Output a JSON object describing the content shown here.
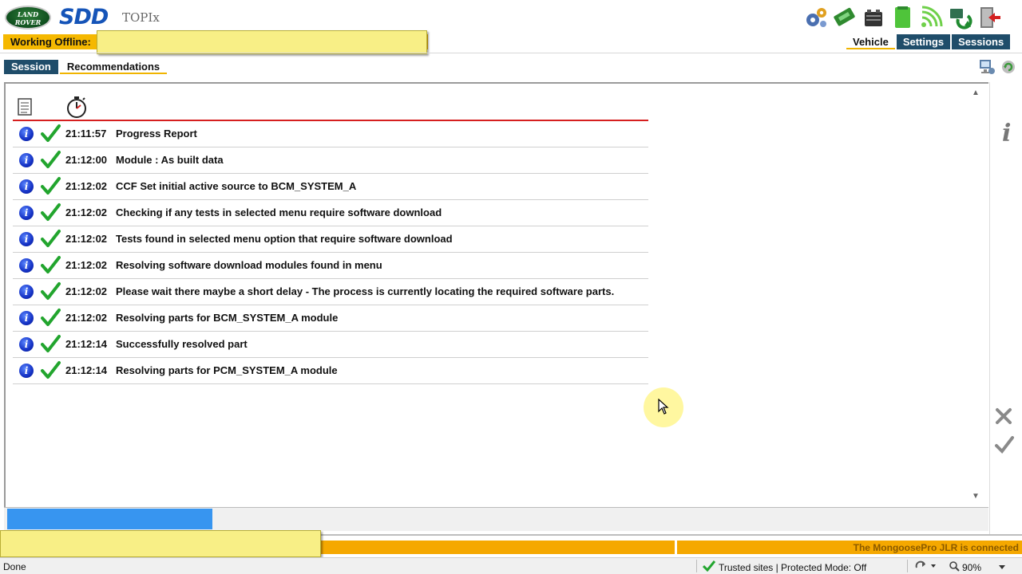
{
  "header": {
    "logo_text": "LAND ROVER",
    "app_name": "SDD",
    "subtitle": "TOPIx",
    "offline_label": "Working Offline:",
    "offline_value": ""
  },
  "toolbar": {
    "icons": [
      "settings-gears-icon",
      "vehicle-interface-icon",
      "battery-icon",
      "document-green-icon",
      "wireless-signal-icon",
      "network-refresh-icon",
      "exit-door-icon"
    ]
  },
  "main_tabs": {
    "vehicle": "Vehicle",
    "settings": "Settings",
    "sessions": "Sessions"
  },
  "sub_tabs": {
    "session": "Session",
    "recommendations": "Recommendations"
  },
  "log": {
    "columns": [
      "document-icon",
      "stopwatch-icon"
    ],
    "rows": [
      {
        "time": "21:11:57",
        "message": "Progress Report"
      },
      {
        "time": "21:12:00",
        "message": "Module : As built data"
      },
      {
        "time": "21:12:02",
        "message": "CCF Set initial active source to BCM_SYSTEM_A"
      },
      {
        "time": "21:12:02",
        "message": "Checking if any tests in selected menu require software download"
      },
      {
        "time": "21:12:02",
        "message": "Tests found in selected menu option that require software download"
      },
      {
        "time": "21:12:02",
        "message": "Resolving software download modules found in menu"
      },
      {
        "time": "21:12:02",
        "message": "Please wait there maybe a short delay - The process is currently locating the required software parts."
      },
      {
        "time": "21:12:02",
        "message": "Resolving parts for BCM_SYSTEM_A module"
      },
      {
        "time": "21:12:14",
        "message": "Successfully resolved part"
      },
      {
        "time": "21:12:14",
        "message": "Resolving parts for PCM_SYSTEM_A module"
      }
    ]
  },
  "progress": {
    "fraction": 0.21
  },
  "footer": {
    "connection_text": "The MongoosePro JLR is connected"
  },
  "statusbar": {
    "left": "Done",
    "security": "Trusted sites | Protected Mode: Off",
    "zoom": "90%"
  },
  "colors": {
    "accent_yellow": "#f5b800",
    "tab_blue": "#1f4d6a",
    "info_blue": "#1431c4",
    "check_green": "#22a52e",
    "red_rule": "#d61f1f",
    "progress_blue": "#3795f0"
  }
}
